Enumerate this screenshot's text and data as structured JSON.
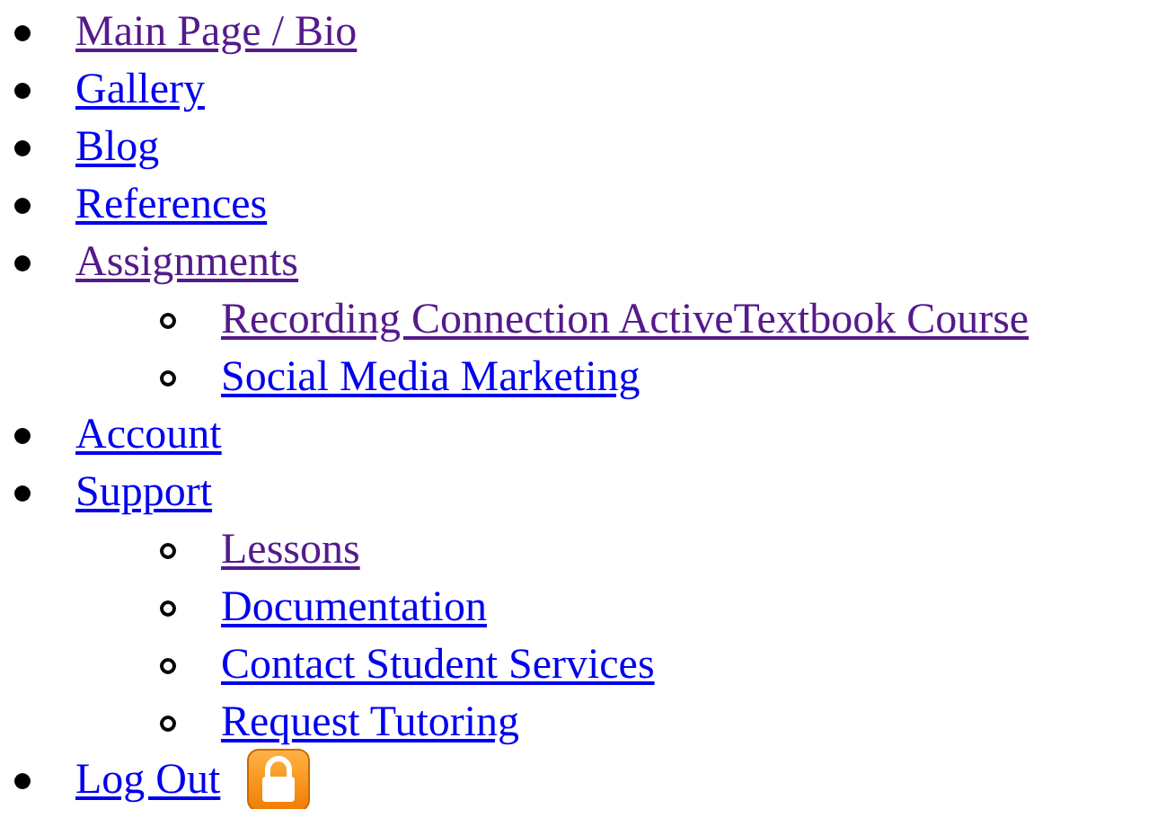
{
  "menu": [
    {
      "label": "Main Page / Bio",
      "visited": true
    },
    {
      "label": "Gallery",
      "visited": false
    },
    {
      "label": "Blog",
      "visited": false
    },
    {
      "label": "References",
      "visited": false
    },
    {
      "label": "Assignments",
      "visited": true,
      "children": [
        {
          "label": "Recording Connection ActiveTextbook Course",
          "visited": true
        },
        {
          "label": "Social Media Marketing",
          "visited": false
        }
      ]
    },
    {
      "label": "Account",
      "visited": false
    },
    {
      "label": "Support",
      "visited": false,
      "children": [
        {
          "label": "Lessons",
          "visited": true
        },
        {
          "label": "Documentation",
          "visited": false
        },
        {
          "label": "Contact Student Services",
          "visited": false
        },
        {
          "label": "Request Tutoring",
          "visited": false
        }
      ]
    },
    {
      "label": "Log Out",
      "visited": false,
      "kind": "lock"
    }
  ]
}
